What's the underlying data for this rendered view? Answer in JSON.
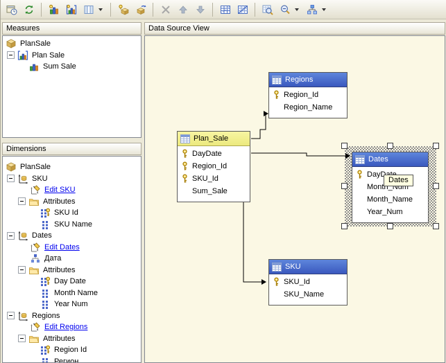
{
  "toolbar": {
    "icons": [
      "designer",
      "refresh",
      "new-measure",
      "new-measure-group",
      "show-columns",
      "add-cube-dimension",
      "dimension-wizard",
      "delete",
      "move-up",
      "move-down",
      "show-grid",
      "snap-to-grid",
      "browse-data",
      "zoom-out",
      "change-layout"
    ]
  },
  "panels": {
    "measures": {
      "title": "Measures",
      "tree": [
        {
          "label": "PlanSale",
          "icon": "cube"
        },
        {
          "label": "Plan Sale",
          "icon": "measure-group",
          "expander": "minus"
        },
        {
          "label": "Sum Sale",
          "icon": "measure"
        }
      ]
    },
    "dimensions": {
      "title": "Dimensions",
      "tree": [
        {
          "label": "PlanSale",
          "icon": "cube"
        },
        {
          "label": "SKU",
          "icon": "dimension",
          "expander": "minus"
        },
        {
          "label": "Edit SKU",
          "icon": "edit",
          "link": true
        },
        {
          "label": "Attributes",
          "icon": "folder",
          "expander": "minus"
        },
        {
          "label": "SKU Id",
          "icon": "key-attribute"
        },
        {
          "label": "SKU Name",
          "icon": "attribute"
        },
        {
          "label": "Dates",
          "icon": "dimension",
          "expander": "minus"
        },
        {
          "label": "Edit Dates",
          "icon": "edit",
          "link": true
        },
        {
          "label": "Дата",
          "icon": "hierarchy"
        },
        {
          "label": "Attributes",
          "icon": "folder",
          "expander": "minus"
        },
        {
          "label": "Day Date",
          "icon": "key-attribute"
        },
        {
          "label": "Month Name",
          "icon": "attribute"
        },
        {
          "label": "Year Num",
          "icon": "attribute"
        },
        {
          "label": "Regions",
          "icon": "dimension",
          "expander": "minus"
        },
        {
          "label": "Edit Regions",
          "icon": "edit",
          "link": true
        },
        {
          "label": "Attributes",
          "icon": "folder",
          "expander": "minus"
        },
        {
          "label": "Region Id",
          "icon": "key-attribute"
        },
        {
          "label": "Регион",
          "icon": "attribute"
        }
      ]
    },
    "data_source_view": {
      "title": "Data Source View"
    }
  },
  "diagram": {
    "tooltip": "Dates",
    "tables": [
      {
        "name": "Regions",
        "fields": [
          {
            "name": "Region_Id",
            "key": true
          },
          {
            "name": "Region_Name",
            "key": false
          }
        ]
      },
      {
        "name": "Plan_Sale",
        "highlighted": true,
        "fields": [
          {
            "name": "DayDate",
            "key": true
          },
          {
            "name": "Region_Id",
            "key": true
          },
          {
            "name": "SKU_Id",
            "key": true
          },
          {
            "name": "Sum_Sale",
            "key": false
          }
        ]
      },
      {
        "name": "Dates",
        "selected": true,
        "fields": [
          {
            "name": "DayDate",
            "key": true
          },
          {
            "name": "Month_Num",
            "key": false
          },
          {
            "name": "Month_Name",
            "key": false
          },
          {
            "name": "Year_Num",
            "key": false
          }
        ]
      },
      {
        "name": "SKU",
        "fields": [
          {
            "name": "SKU_Id",
            "key": true
          },
          {
            "name": "SKU_Name",
            "key": false
          }
        ]
      }
    ],
    "colors": {
      "table_header_blue": "#3F5FC2",
      "selected_table_header_yellow": "#F2F08F",
      "canvas_background": "#FBF8E4",
      "tooltip_background": "#FFFFE1",
      "link_color": "#0000EE"
    }
  }
}
